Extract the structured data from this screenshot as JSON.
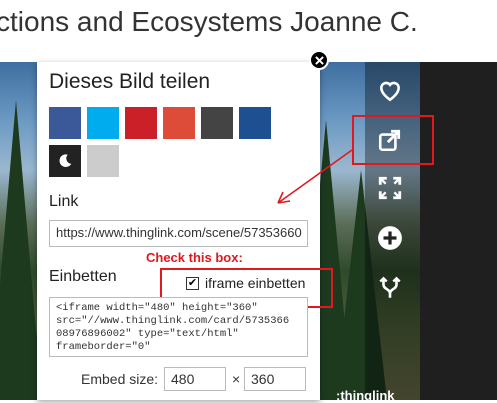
{
  "page": {
    "title": "ctions and Ecosystems Joanne C."
  },
  "share_panel": {
    "title": "Dieses Bild teilen",
    "social_colors": [
      "#3b5998",
      "#00acee",
      "#cb2027",
      "#dd4b39",
      "#444444",
      "#1e4f91",
      "#222222",
      "#cccccc"
    ],
    "link_label": "Link",
    "link_value": "https://www.thinglink.com/scene/57353660",
    "embed_label": "Einbetten",
    "iframe_checkbox_label": "iframe einbetten",
    "iframe_checked": true,
    "embed_code": "<iframe width=\"480\" height=\"360\"\nsrc=\"//www.thinglink.com/card/5735366\n08976896002\" type=\"text/html\"\nframeborder=\"0\"",
    "embed_size_label": "Embed size:",
    "embed_width": "480",
    "embed_height": "360",
    "times_sign": "×"
  },
  "annotation": {
    "text": "Check this box:",
    "color": "#e0191e"
  },
  "toolbar": {
    "icons": [
      "heart-icon",
      "share-icon",
      "fullscreen-icon",
      "plus-icon",
      "fork-icon"
    ]
  },
  "watermark": ":thinglink"
}
